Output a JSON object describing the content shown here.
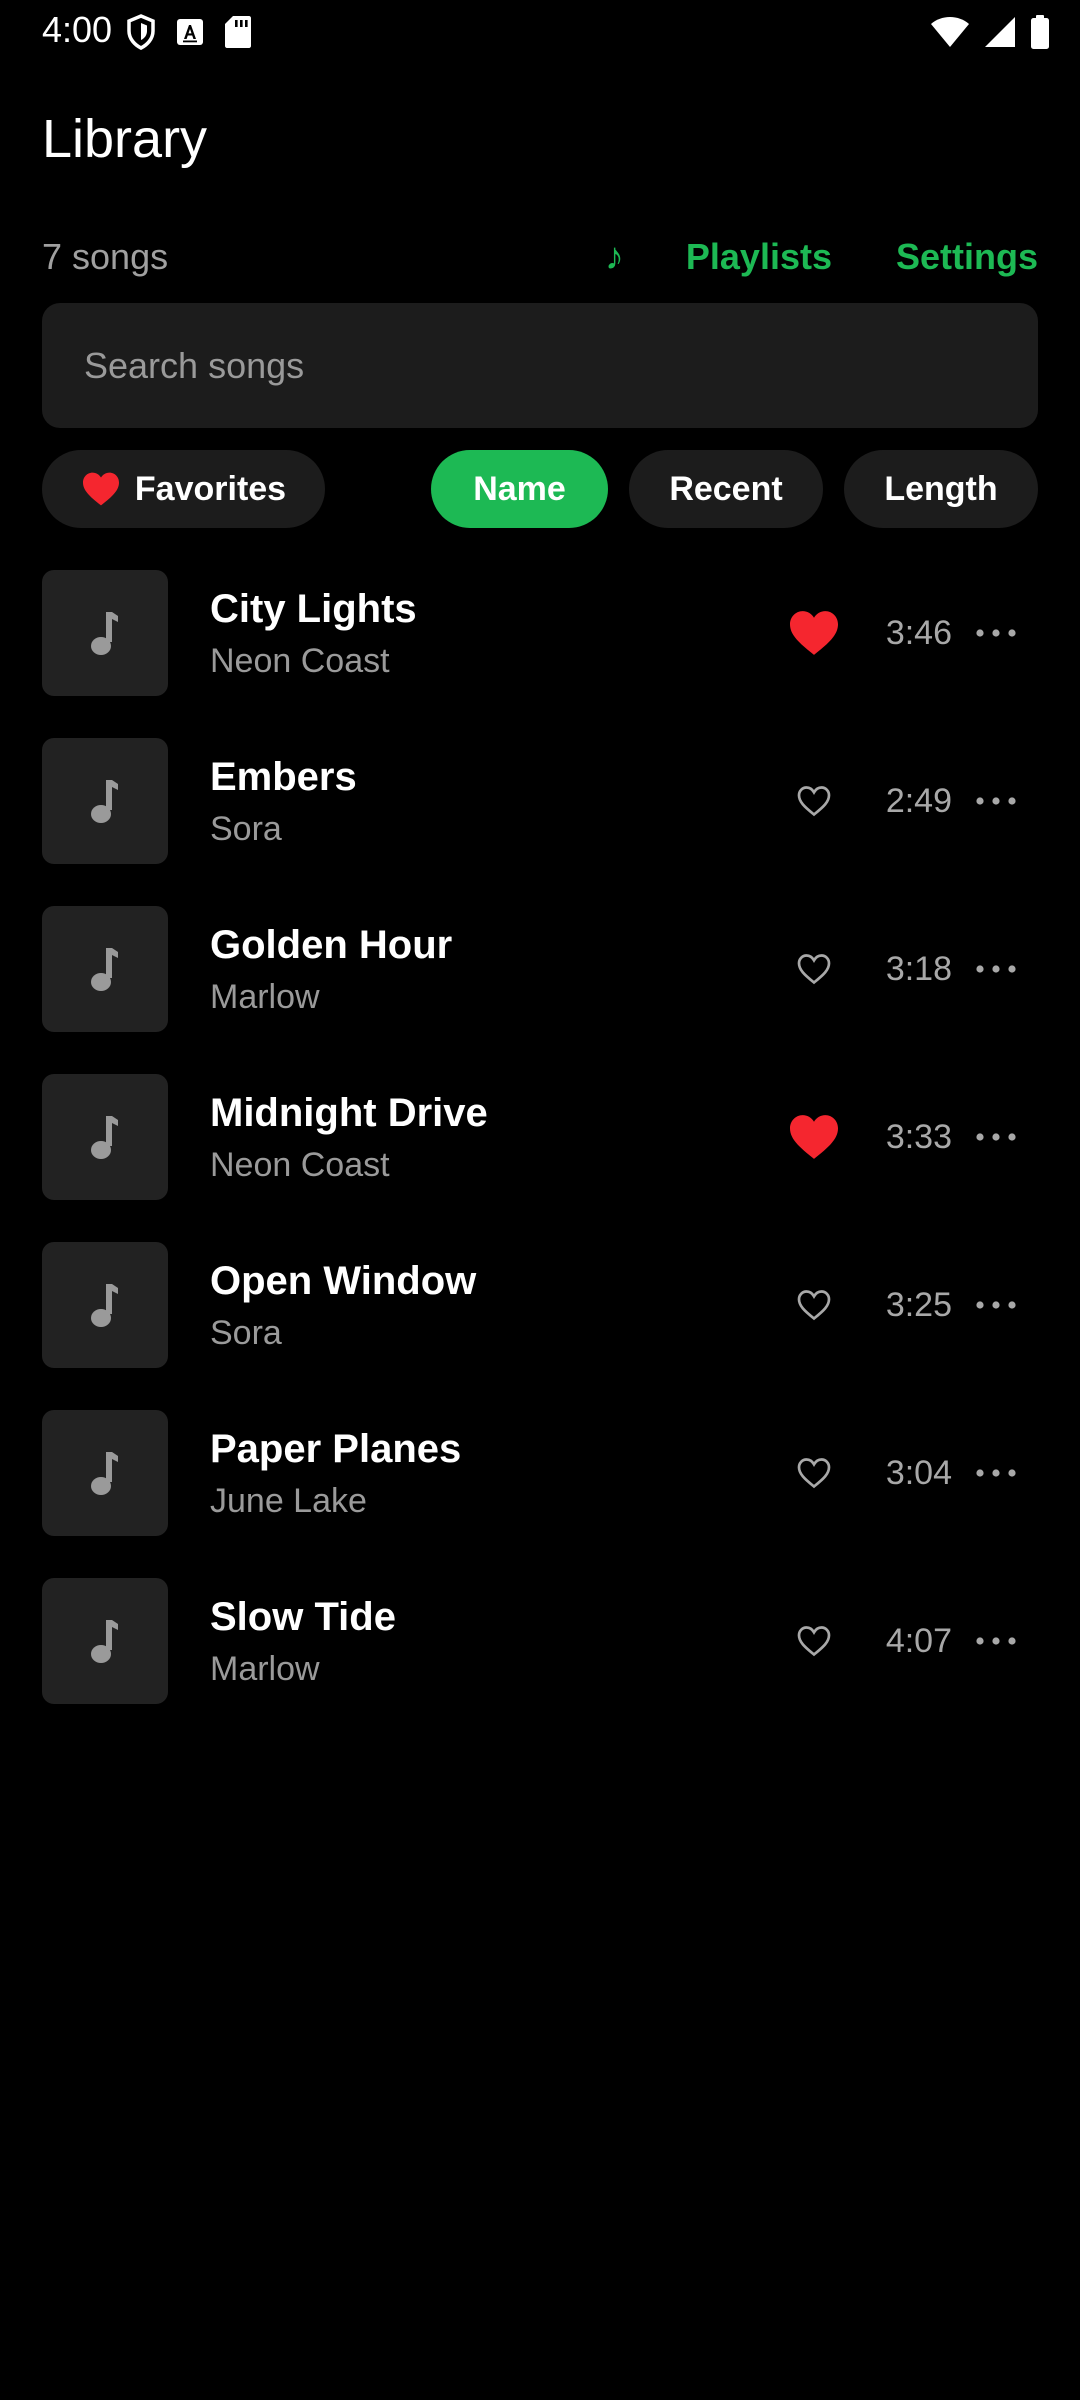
{
  "status_bar": {
    "time": "4:00"
  },
  "header": {
    "title": "Library"
  },
  "toolbar": {
    "song_count": "7 songs",
    "note_glyph": "♪",
    "playlists_label": "Playlists",
    "settings_label": "Settings"
  },
  "search": {
    "value": "",
    "placeholder": "Search songs"
  },
  "filters": {
    "favorites_label": "Favorites",
    "sort_options": [
      "Name",
      "Recent",
      "Length"
    ],
    "selected_sort": "Name"
  },
  "songs": [
    {
      "title": "City Lights",
      "artist": "Neon Coast",
      "duration": "3:46",
      "favorite": true
    },
    {
      "title": "Embers",
      "artist": "Sora",
      "duration": "2:49",
      "favorite": false
    },
    {
      "title": "Golden Hour",
      "artist": "Marlow",
      "duration": "3:18",
      "favorite": false
    },
    {
      "title": "Midnight Drive",
      "artist": "Neon Coast",
      "duration": "3:33",
      "favorite": true
    },
    {
      "title": "Open Window",
      "artist": "Sora",
      "duration": "3:25",
      "favorite": false
    },
    {
      "title": "Paper Planes",
      "artist": "June Lake",
      "duration": "3:04",
      "favorite": false
    },
    {
      "title": "Slow Tide",
      "artist": "Marlow",
      "duration": "4:07",
      "favorite": false
    }
  ],
  "icons": {
    "song_art": "music-note-icon",
    "favorite_on": "heart-filled-icon",
    "favorite_off": "heart-outline-icon",
    "more": "more-horizontal-icon"
  },
  "colors": {
    "background": "#000000",
    "accent": "#1db954",
    "favorite": "#f5262f",
    "surface": "#1c1c1c",
    "secondary_text": "#9a9a9a"
  }
}
